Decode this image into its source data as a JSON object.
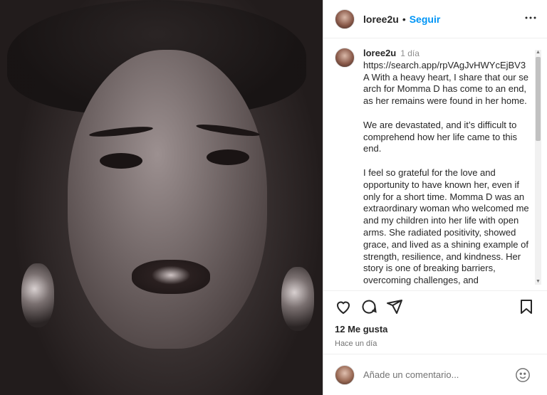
{
  "post": {
    "image_alt_icon": "photo-portrait"
  },
  "header": {
    "username": "loree2u",
    "separator": "•",
    "follow_label": "Seguir",
    "more_label": "•••"
  },
  "caption": {
    "username": "loree2u",
    "time": "1 día",
    "paragraphs": [
      "https://search.app/rpVAgJvHWYcEjBV3 A With a heavy heart, I share that our search for Momma D has come to an end, as her remains were found in her home.",
      "We are devastated, and it’s difficult to comprehend how her life came to this end.",
      "I feel so grateful for the love and opportunity to have known her, even if only for a short time. Momma D was an extraordinary woman who welcomed me and my children into her life with open arms. She radiated positivity, showed grace, and lived as a shining example of strength, resilience, and kindness. Her story is one of breaking barriers, overcoming challenges, and"
    ]
  },
  "actions": {
    "likes": "12 Me gusta",
    "time_ago": "Hace un día"
  },
  "comment_box": {
    "placeholder": "Añade un comentario..."
  },
  "icons": {
    "like": "heart-icon",
    "comment": "comment-icon",
    "share": "send-icon",
    "save": "bookmark-icon",
    "emoji": "emoji-icon",
    "more": "more-icon"
  },
  "colors": {
    "accent": "#0095f6",
    "text": "#262626",
    "muted": "#737373"
  }
}
